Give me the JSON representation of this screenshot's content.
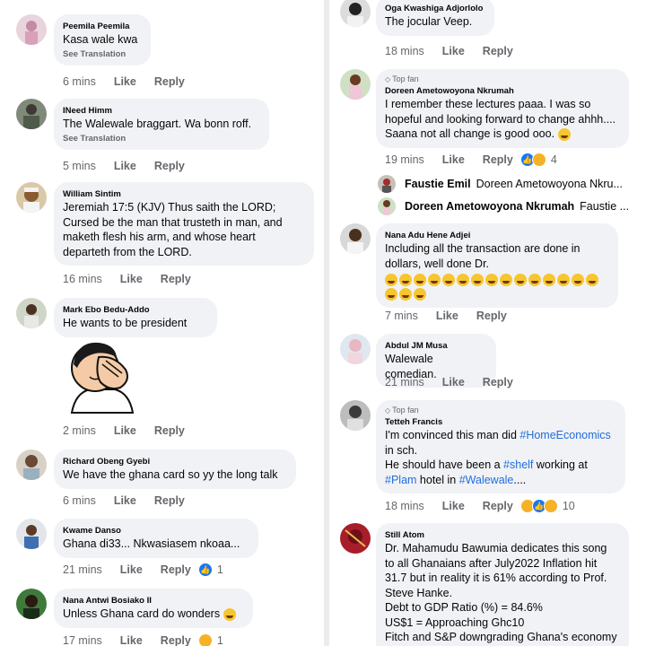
{
  "left": {
    "comments": [
      {
        "name": "Peemila Peemila",
        "text": "Kasa wale kwa",
        "see_translation": "See Translation",
        "time": "6 mins",
        "like": "Like",
        "reply": "Reply"
      },
      {
        "name": "INeed Himm",
        "text": "The Walewale braggart. Wa bonn roff.",
        "see_translation": "See Translation",
        "time": "5 mins",
        "like": "Like",
        "reply": "Reply"
      },
      {
        "name": "William Sintim",
        "text": "Jeremiah 17:5 (KJV)  Thus saith the LORD;\nCursed be the man that trusteth in man, and\nmaketh flesh his arm, and whose heart\ndeparteth from the LORD.",
        "time": "16 mins",
        "like": "Like",
        "reply": "Reply"
      },
      {
        "name": "Mark Ebo Bedu-Addo",
        "text": "He wants to be president",
        "time": "2 mins",
        "like": "Like",
        "reply": "Reply",
        "sticker": "facepalm-sticker"
      },
      {
        "name": "Richard Obeng Gyebi",
        "text": "We have the ghana card so yy  the long talk",
        "time": "6 mins",
        "like": "Like",
        "reply": "Reply"
      },
      {
        "name": "Kwame Danso",
        "text": "Ghana di33... Nkwasiasem nkoaa...",
        "time": "21 mins",
        "like": "Like",
        "reply": "Reply",
        "reaction_count": "1"
      },
      {
        "name": "Nana Antwi Bosiako II",
        "text": "Unless Ghana card do wonders",
        "time": "17 mins",
        "like": "Like",
        "reply": "Reply",
        "reaction_count": "1"
      }
    ]
  },
  "right": {
    "comments": [
      {
        "name": "Oga Kwashiga Adjorlolo",
        "text": "The jocular Veep.",
        "time": "18 mins",
        "like": "Like",
        "reply": "Reply"
      },
      {
        "badge": "Top fan",
        "name": "Doreen Ametowoyona Nkrumah",
        "text": "I remember these lectures paaa. I was so\nhopeful and looking forward to change ahhh....\nSaana not all change is good ooo.",
        "time": "19 mins",
        "like": "Like",
        "reply": "Reply",
        "reaction_count": "4"
      },
      {
        "name": "Nana Adu Hene Adjei",
        "text": "Including all the transaction are done in\ndollars, well done Dr.",
        "time": "7 mins",
        "like": "Like",
        "reply": "Reply"
      },
      {
        "name": "Abdul JM Musa",
        "text": "Walewale comedian.",
        "time": "21 mins",
        "like": "Like",
        "reply": "Reply"
      },
      {
        "badge": "Top fan",
        "name": "Tetteh Francis",
        "text_pre": "I'm convinced this man did ",
        "tag1": "#HomeEconomics",
        "text_mid1": "\nin sch.\nHe should have been a ",
        "tag2": "#shelf",
        "text_mid2": " working at\n",
        "tag3": "#Plam",
        "text_mid3": " hotel in ",
        "tag4": "#Walewale",
        "text_post": "....",
        "time": "18 mins",
        "like": "Like",
        "reply": "Reply",
        "reaction_count": "10"
      },
      {
        "name": "Still Atom",
        "text": "Dr. Mahamudu Bawumia dedicates this song\nto all Ghanaians after July2022 Inflation hit\n31.7 but in reality it is 61% according to Prof.\nSteve Hanke.\nDebt to GDP Ratio (%) = 84.6%\nUS$1 = Approaching Ghc10\nFitch and S&P downgrading Ghana's economy"
      }
    ],
    "replies": [
      {
        "name": "Faustie Emil",
        "preview": "Doreen Ametowoyona Nkru..."
      },
      {
        "name": "Doreen Ametowoyona Nkrumah",
        "preview": "Faustie ..."
      }
    ]
  },
  "colors": {
    "bubble": "#f0f2f5",
    "meta": "#65676b",
    "hashtag": "#216fdb",
    "like_blue": "#1877f2"
  }
}
